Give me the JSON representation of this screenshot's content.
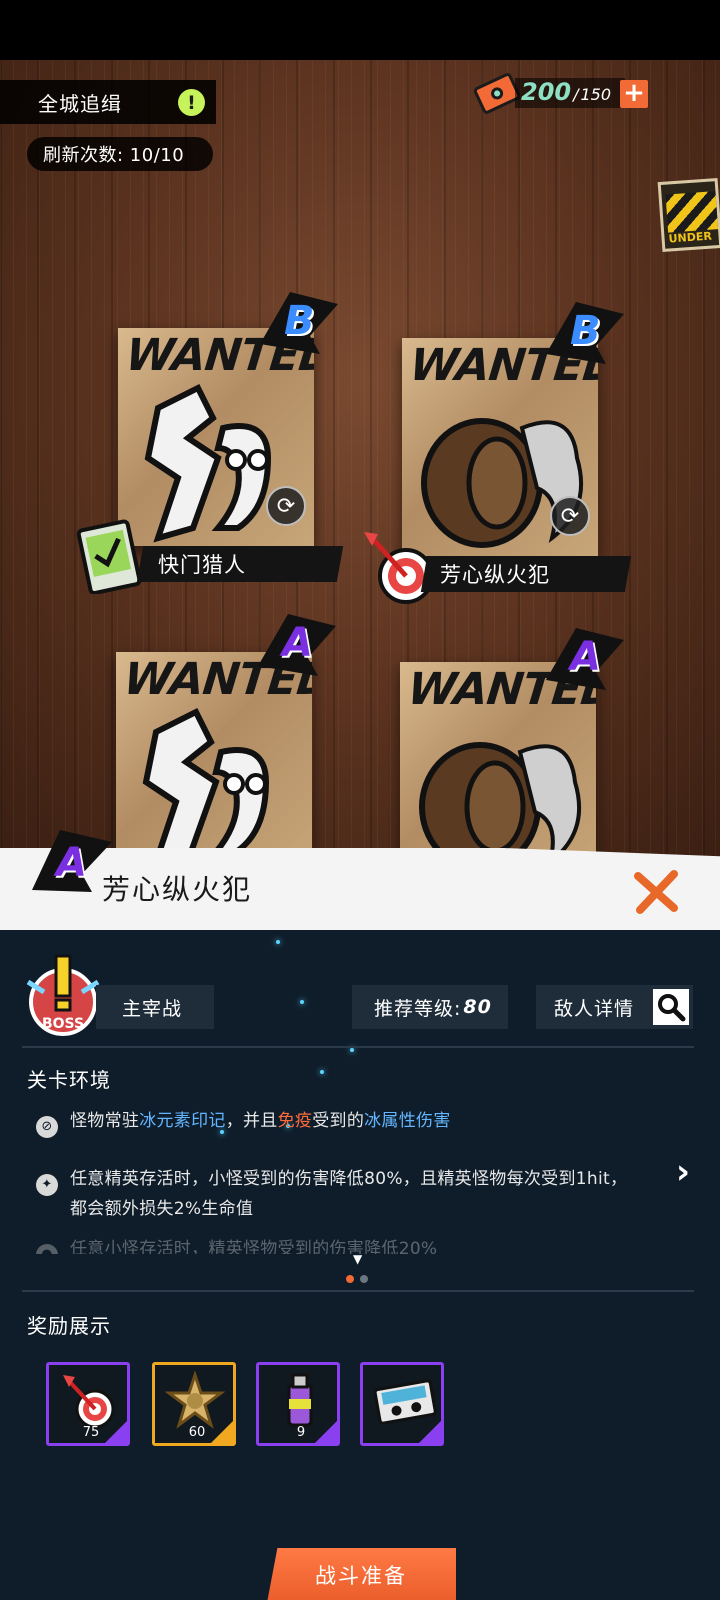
{
  "header": {
    "mode_title": "全城追缉",
    "info_icon": "exclamation-icon",
    "refresh_count": "刷新次数: 10/10",
    "currency": {
      "current": "200",
      "separator": "/",
      "max": "150",
      "add_icon": "plus-icon"
    },
    "side_banner_label": "UNDER"
  },
  "posters": [
    {
      "wanted": "WANTED",
      "rank": "B",
      "name": "快门猎人",
      "icon": "memory-film-icon"
    },
    {
      "wanted": "WANTED",
      "rank": "B",
      "name": "芳心纵火犯",
      "icon": "dart-target-icon"
    },
    {
      "wanted": "WANTED",
      "rank": "A"
    },
    {
      "wanted": "WANTED",
      "rank": "A"
    }
  ],
  "detail": {
    "rank": "A",
    "title": "芳心纵火犯",
    "boss_badge_text": "BOSS",
    "type_label": "主宰战",
    "level_label": "推荐等级:",
    "level_value": "80",
    "enemy_detail_label": "敌人详情",
    "env_section_title": "关卡环境",
    "env": {
      "line1_a": "怪物常驻",
      "line1_b": "冰元素印记",
      "line1_c": "，并且",
      "line1_d": "免疫",
      "line1_e": "受到的",
      "line1_f": "冰属性伤害",
      "line2_a": "任意精英存活时，小怪受到的伤害降低80%，且精英怪物每次受到1hit，",
      "line2_b": "都会额外损失2%生命值",
      "line3": "任意小怪存活时，精英怪物受到的伤害降低20%"
    },
    "reward_section_title": "奖励展示",
    "rewards": [
      {
        "icon": "dart-target-icon",
        "count": "75",
        "rarity_color": "#8a3ff0"
      },
      {
        "icon": "sheriff-star-icon",
        "count": "60",
        "rarity_color": "#f0a820"
      },
      {
        "icon": "spray-can-icon",
        "count": "9",
        "rarity_color": "#8a3ff0"
      },
      {
        "icon": "cassette-tape-icon",
        "count": "",
        "rarity_color": "#8a3ff0"
      }
    ],
    "battle_button": "战斗准备"
  },
  "colors": {
    "accent_orange": "#f26a35",
    "panel_bg": "#0f1d2a",
    "highlight_blue": "#63b6ff",
    "highlight_red": "#ff6a3d",
    "rank_b": "#3a8cff",
    "rank_a": "#7a2fe0"
  }
}
